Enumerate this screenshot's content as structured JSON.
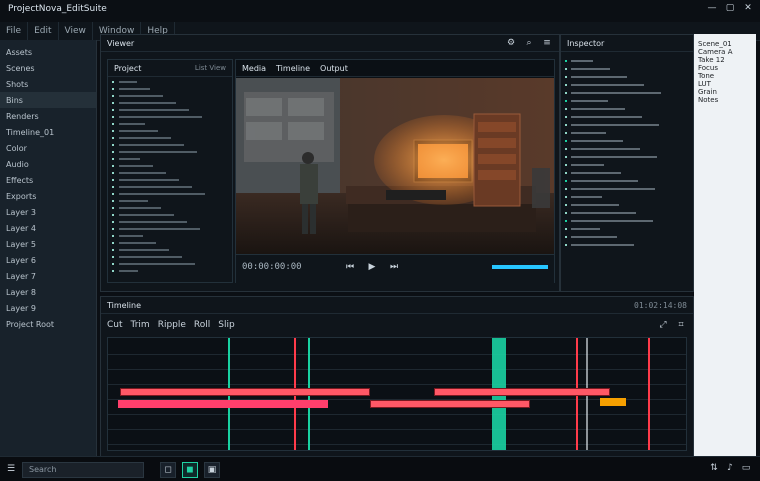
{
  "window": {
    "title": "ProjectNova_EditSuite",
    "menu": [
      "File",
      "Edit",
      "View",
      "Window",
      "Help"
    ],
    "controls": {
      "min": "—",
      "max": "▢",
      "close": "✕"
    }
  },
  "sidebar": {
    "items": [
      {
        "label": "Assets"
      },
      {
        "label": "Scenes"
      },
      {
        "label": "Shots"
      },
      {
        "label": "Bins"
      },
      {
        "label": "Renders"
      },
      {
        "label": "Timeline_01"
      },
      {
        "label": "Color"
      },
      {
        "label": "Audio"
      },
      {
        "label": "Effects"
      },
      {
        "label": "Exports"
      },
      {
        "label": "Layer 3"
      },
      {
        "label": "Layer 4"
      },
      {
        "label": "Layer 5"
      },
      {
        "label": "Layer 6"
      },
      {
        "label": "Layer 7"
      },
      {
        "label": "Layer 8"
      },
      {
        "label": "Layer 9"
      },
      {
        "label": "Project Root"
      }
    ]
  },
  "viewer": {
    "title": "Viewer",
    "tabs": [
      "Media",
      "Timeline",
      "Output"
    ],
    "status": "00:00:00:00",
    "transport": [
      "⏮",
      "▶",
      "⏭"
    ]
  },
  "left_list": {
    "title": "Project",
    "subtitle": "List View",
    "rows": 28
  },
  "right_panel": {
    "title": "Inspector",
    "rows": 24
  },
  "far_right_notes": {
    "lines": [
      "Scene_01",
      "Camera A",
      "Take 12",
      "Focus",
      "Tone",
      "LUT",
      "Grain",
      "Notes"
    ]
  },
  "timeline": {
    "title": "Timeline",
    "toolbar": [
      "Cut",
      "Trim",
      "Ripple",
      "Roll",
      "Slip"
    ],
    "timecode": "01:02:14:08",
    "tracks": 7
  },
  "taskbar": {
    "start": "☰",
    "search": "Search",
    "apps": [
      "◻",
      "◼",
      "▣"
    ]
  },
  "colors": {
    "bg": "#0b0f14",
    "panel": "#121a22",
    "accent_green": "#19d2a2",
    "accent_red": "#ff3b4a",
    "accent_cyan": "#27c5ff",
    "accent_orange": "#f5a000"
  }
}
